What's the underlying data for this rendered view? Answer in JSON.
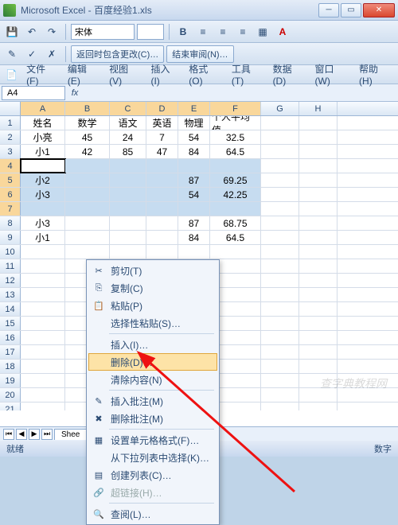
{
  "window": {
    "title": "Microsoft Excel - 百度经验1.xls"
  },
  "toolbar": {
    "font": "宋体",
    "review1": "返回时包含更改(C)…",
    "review2": "结束审阅(N)…"
  },
  "menus": {
    "file": "文件(F)",
    "edit": "编辑(E)",
    "view": "视图(V)",
    "insert": "插入(I)",
    "format": "格式(O)",
    "tools": "工具(T)",
    "data": "数据(D)",
    "window": "窗口(W)",
    "help": "帮助(H)"
  },
  "namebox": "A4",
  "columns": [
    "A",
    "B",
    "C",
    "D",
    "E",
    "F",
    "G",
    "H"
  ],
  "selected_cols": [
    "A",
    "B",
    "C",
    "D",
    "E",
    "F"
  ],
  "headers": {
    "A": "姓名",
    "B": "数学",
    "C": "语文",
    "D": "英语",
    "E": "物理",
    "F": "个人平均值"
  },
  "rows": [
    {
      "n": 1,
      "A": "姓名",
      "B": "数学",
      "C": "语文",
      "D": "英语",
      "E": "物理",
      "F": "个人平均值"
    },
    {
      "n": 2,
      "A": "小亮",
      "B": "45",
      "C": "24",
      "D": "7",
      "E": "54",
      "F": "32.5"
    },
    {
      "n": 3,
      "A": "小1",
      "B": "42",
      "C": "85",
      "D": "47",
      "E": "84",
      "F": "64.5"
    },
    {
      "n": 4,
      "A": "",
      "B": "",
      "C": "",
      "D": "",
      "E": "",
      "F": "",
      "active": true
    },
    {
      "n": 5,
      "A": "小2",
      "B": "",
      "C": "",
      "D": "",
      "E": "87",
      "F": "69.25"
    },
    {
      "n": 6,
      "A": "小3",
      "B": "",
      "C": "",
      "D": "",
      "E": "54",
      "F": "42.25"
    },
    {
      "n": 7,
      "A": "",
      "B": "",
      "C": "",
      "D": "",
      "E": "",
      "F": ""
    },
    {
      "n": 8,
      "A": "小3",
      "B": "",
      "C": "",
      "D": "",
      "E": "87",
      "F": "68.75"
    },
    {
      "n": 9,
      "A": "小1",
      "B": "",
      "C": "",
      "D": "",
      "E": "84",
      "F": "64.5"
    },
    {
      "n": 10
    },
    {
      "n": 11
    },
    {
      "n": 12
    },
    {
      "n": 13
    },
    {
      "n": 14
    },
    {
      "n": 15
    },
    {
      "n": 16
    },
    {
      "n": 17
    },
    {
      "n": 18
    },
    {
      "n": 19
    },
    {
      "n": 20
    },
    {
      "n": 21
    }
  ],
  "selected_rows": [
    4,
    5,
    6,
    7
  ],
  "context_menu": {
    "cut": "剪切(T)",
    "copy": "复制(C)",
    "paste": "粘贴(P)",
    "paste_special": "选择性粘贴(S)…",
    "insert": "插入(I)…",
    "delete": "删除(D)…",
    "clear": "清除内容(N)",
    "insert_comment": "插入批注(M)",
    "delete_comment": "删除批注(M)",
    "format_cells": "设置单元格格式(F)…",
    "dropdown": "从下拉列表中选择(K)…",
    "create_list": "创建列表(C)…",
    "hyperlink": "超链接(H)…",
    "lookup": "查阅(L)…"
  },
  "sheet_tab": "Shee",
  "status": {
    "left": "就绪",
    "right": "数字"
  },
  "watermark": "查字典教程网"
}
